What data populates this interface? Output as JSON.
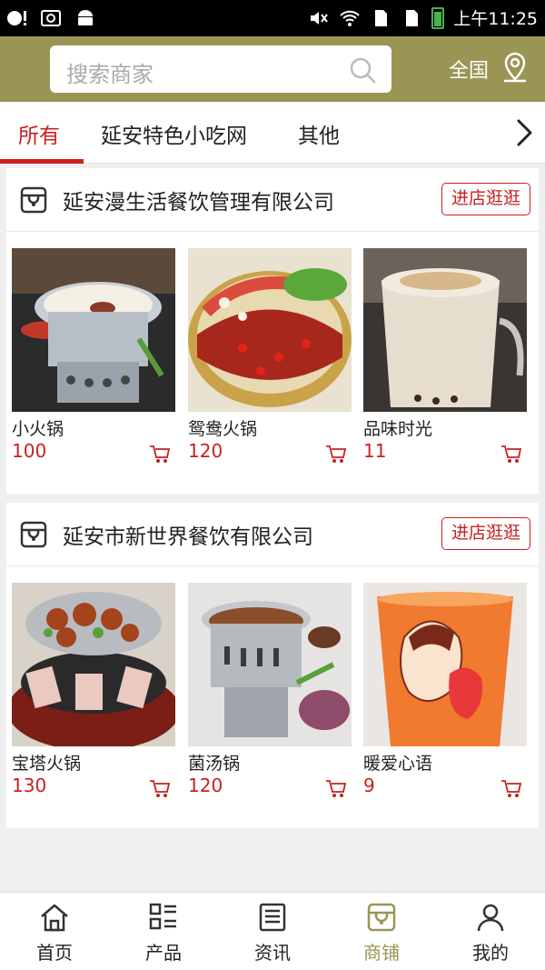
{
  "status_bar": {
    "time": "上午11:25"
  },
  "header": {
    "search_placeholder": "搜索商家",
    "region_label": "全国",
    "bg_color": "#9a9555"
  },
  "tabs": [
    {
      "label": "所有",
      "active": true
    },
    {
      "label": "延安特色小吃网",
      "active": false
    },
    {
      "label": "其他",
      "active": false
    }
  ],
  "shops": [
    {
      "name": "延安漫生活餐饮管理有限公司",
      "visit_label": "进店逛逛",
      "products": [
        {
          "name": "小火锅",
          "price": "100",
          "image": "hotpot-pot"
        },
        {
          "name": "鸳鸯火锅",
          "price": "120",
          "image": "yuanyang-hotpot"
        },
        {
          "name": "品味时光",
          "price": "11",
          "image": "milk-tea"
        }
      ]
    },
    {
      "name": "延安市新世界餐饮有限公司",
      "visit_label": "进店逛逛",
      "products": [
        {
          "name": "宝塔火锅",
          "price": "130",
          "image": "pagoda-hotpot"
        },
        {
          "name": "菌汤锅",
          "price": "120",
          "image": "mushroom-soup-pot"
        },
        {
          "name": "暖爱心语",
          "price": "9",
          "image": "fruit-tea-cup"
        }
      ]
    }
  ],
  "bottom_nav": [
    {
      "label": "首页",
      "icon": "home-icon",
      "active": false
    },
    {
      "label": "产品",
      "icon": "products-grid-icon",
      "active": false
    },
    {
      "label": "资讯",
      "icon": "news-icon",
      "active": false
    },
    {
      "label": "商铺",
      "icon": "store-icon",
      "active": true
    },
    {
      "label": "我的",
      "icon": "user-icon",
      "active": false
    }
  ],
  "colors": {
    "accent": "#c9201f",
    "brand": "#9a9555"
  }
}
